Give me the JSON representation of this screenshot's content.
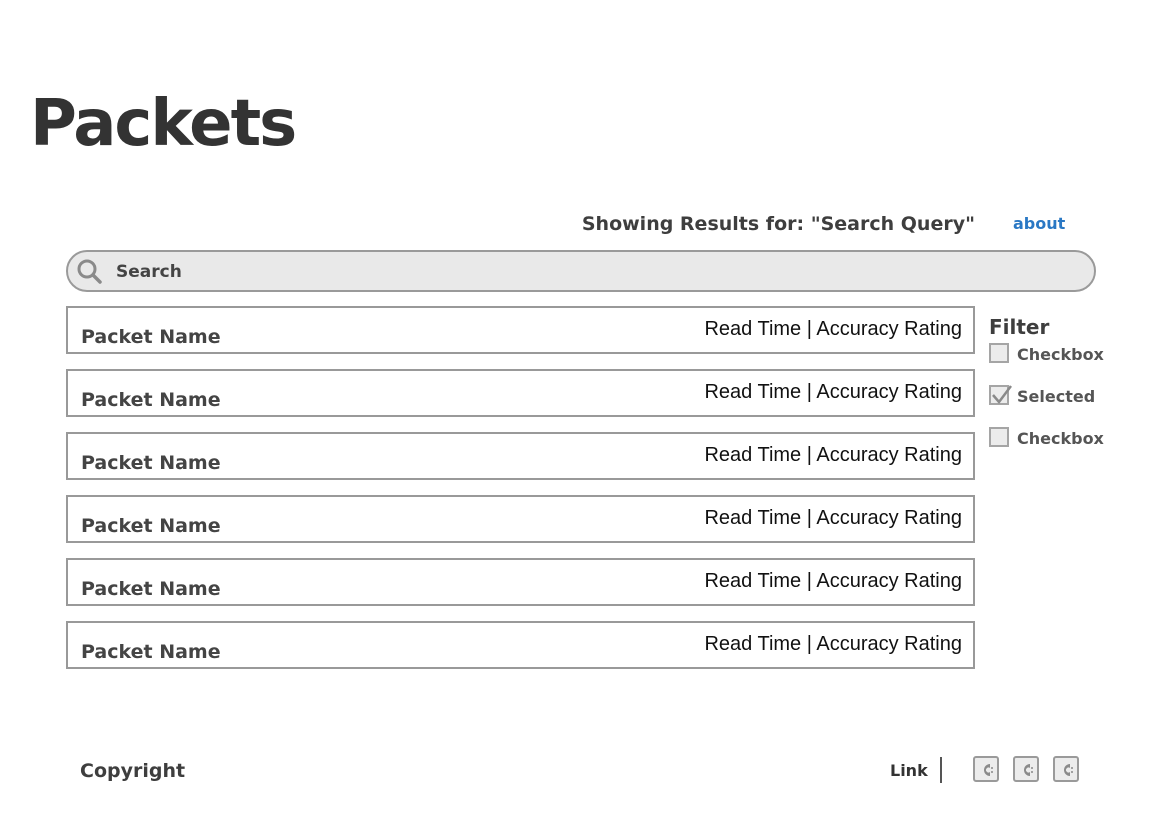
{
  "page": {
    "title": "Packets"
  },
  "results": {
    "heading": "Showing Results for: \"Search Query\"",
    "about_label": "about"
  },
  "search": {
    "placeholder": "Search",
    "value": ""
  },
  "packets": [
    {
      "name": "Packet Name",
      "meta": "Read Time | Accuracy Rating"
    },
    {
      "name": "Packet Name",
      "meta": "Read Time | Accuracy Rating"
    },
    {
      "name": "Packet Name",
      "meta": "Read Time | Accuracy Rating"
    },
    {
      "name": "Packet Name",
      "meta": "Read Time | Accuracy Rating"
    },
    {
      "name": "Packet Name",
      "meta": "Read Time | Accuracy Rating"
    },
    {
      "name": "Packet Name",
      "meta": "Read Time | Accuracy Rating"
    }
  ],
  "filter": {
    "title": "Filter",
    "options": [
      {
        "label": "Checkbox",
        "checked": false
      },
      {
        "label": "Selected",
        "checked": true
      },
      {
        "label": "Checkbox",
        "checked": false
      }
    ]
  },
  "footer": {
    "copyright": "Copyright",
    "link_label": "Link",
    "social_icons": [
      "social-icon",
      "social-icon",
      "social-icon"
    ]
  },
  "colors": {
    "accent_link": "#2a78c4",
    "border": "#999999",
    "search_bg": "#e9e9e9",
    "text": "#3e3e3e"
  }
}
